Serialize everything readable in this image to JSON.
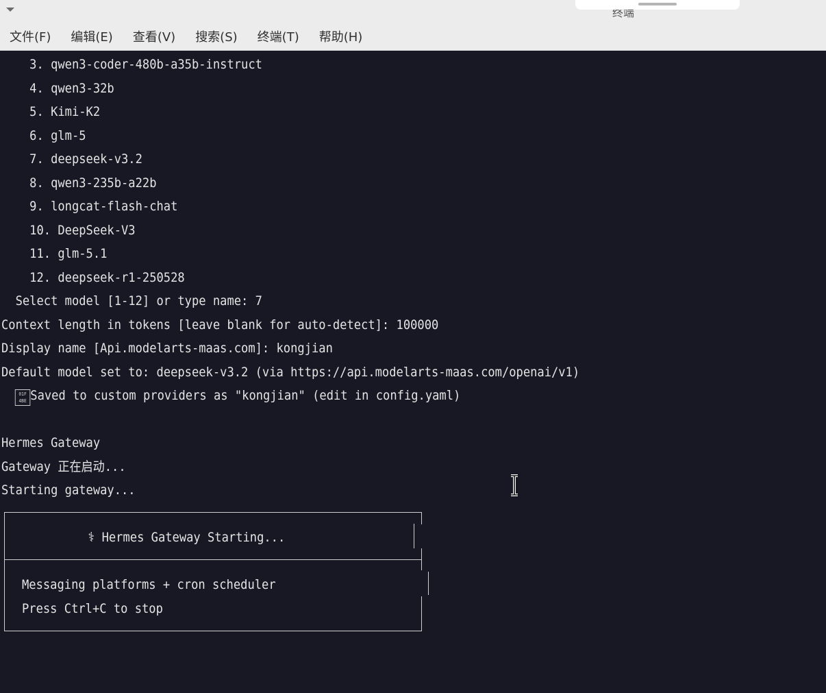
{
  "window": {
    "title": "终端"
  },
  "menubar": {
    "items": [
      "文件(F)",
      "编辑(E)",
      "查看(V)",
      "搜索(S)",
      "终端(T)",
      "帮助(H)"
    ]
  },
  "terminal": {
    "model_list": [
      "    3. qwen3-coder-480b-a35b-instruct",
      "    4. qwen3-32b",
      "    5. Kimi-K2",
      "    6. glm-5",
      "    7. deepseek-v3.2",
      "    8. qwen3-235b-a22b",
      "    9. longcat-flash-chat",
      "    10. DeepSeek-V3",
      "    11. glm-5.1",
      "    12. deepseek-r1-250528"
    ],
    "select_prompt": "  Select model [1-12] or type name: 7",
    "context_length": "Context length in tokens [leave blank for auto-detect]: 100000",
    "display_name": "Display name [Api.modelarts-maas.com]: kongjian",
    "default_model": "Default model set to: deepseek-v3.2 (via https://api.modelarts-maas.com/openai/v1)",
    "saved_glyph": "01F 4BE",
    "saved_msg": "Saved to custom providers as \"kongjian\" (edit in config.yaml)",
    "gateway_header": "Hermes Gateway",
    "gateway_starting_cn": "Gateway 正在启动...",
    "starting_gateway": "Starting gateway...",
    "banner": {
      "title": "⚕ Hermes Gateway Starting...",
      "line1": "Messaging platforms + cron scheduler",
      "line2": "Press Ctrl+C to stop"
    }
  }
}
